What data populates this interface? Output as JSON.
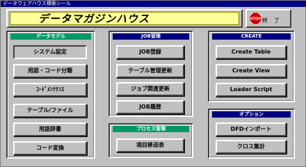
{
  "window": {
    "title": "データウェアハウス構築シール"
  },
  "banner": {
    "title": "データマガジンハウス"
  },
  "exit": {
    "icon_text": "STOP",
    "label": "終了"
  },
  "data_model": {
    "header": "データモデル",
    "buttons": [
      "システム設定",
      "用語・コード分類",
      "ｺｰﾄﾞﾒﾝﾃﾅﾝｽ",
      "テーブル/ファイル",
      "用語辞書",
      "コード変換"
    ]
  },
  "job": {
    "header": "JOB管理",
    "buttons": [
      "JOB登録",
      "テーブル管理更新",
      "ジョブ関連更新",
      "JOB履歴"
    ]
  },
  "process": {
    "header": "プロセス管理",
    "buttons": [
      "項目移送表"
    ]
  },
  "create": {
    "header": "CREATE",
    "buttons": [
      "Create Table",
      "Create View",
      "Loader Script"
    ]
  },
  "option": {
    "header": "オプション",
    "buttons": [
      "DFDインポート",
      "クロス集計"
    ]
  },
  "colors": {
    "title_bar": "#000080",
    "banner": "#ffff99",
    "green_header": "#009966",
    "navy_header": "#000080",
    "stop_red": "#cc0000"
  }
}
